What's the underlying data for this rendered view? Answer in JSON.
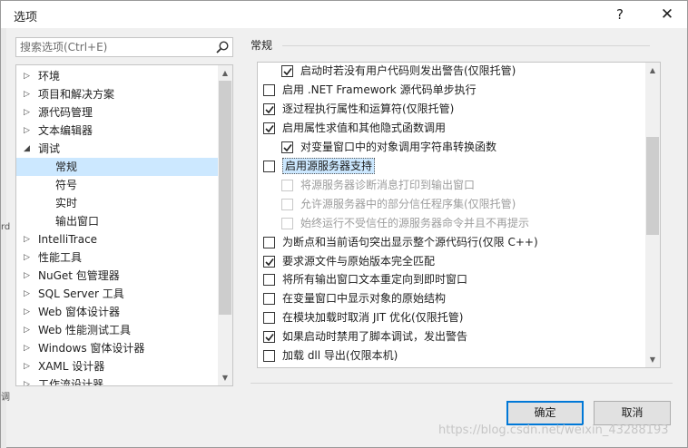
{
  "window": {
    "title": "选项",
    "help": "?",
    "close": "✕"
  },
  "search": {
    "placeholder": "搜索选项(Ctrl+E)"
  },
  "tree": {
    "items": [
      {
        "label": "环境",
        "level": 0,
        "expanded": false
      },
      {
        "label": "项目和解决方案",
        "level": 0,
        "expanded": false
      },
      {
        "label": "源代码管理",
        "level": 0,
        "expanded": false
      },
      {
        "label": "文本编辑器",
        "level": 0,
        "expanded": false
      },
      {
        "label": "调试",
        "level": 0,
        "expanded": true
      },
      {
        "label": "常规",
        "level": 1,
        "selected": true
      },
      {
        "label": "符号",
        "level": 1
      },
      {
        "label": "实时",
        "level": 1
      },
      {
        "label": "输出窗口",
        "level": 1
      },
      {
        "label": "IntelliTrace",
        "level": 0,
        "expanded": false
      },
      {
        "label": "性能工具",
        "level": 0,
        "expanded": false
      },
      {
        "label": "NuGet 包管理器",
        "level": 0,
        "expanded": false
      },
      {
        "label": "SQL Server 工具",
        "level": 0,
        "expanded": false
      },
      {
        "label": "Web 窗体设计器",
        "level": 0,
        "expanded": false
      },
      {
        "label": "Web 性能测试工具",
        "level": 0,
        "expanded": false
      },
      {
        "label": "Windows 窗体设计器",
        "level": 0,
        "expanded": false
      },
      {
        "label": "XAML 设计器",
        "level": 0,
        "expanded": false
      },
      {
        "label": "工作流设计器",
        "level": 0,
        "expanded": false
      }
    ]
  },
  "section": {
    "title": "常规"
  },
  "options": [
    {
      "label": "启动时若没有用户代码则发出警告(仅限托管)",
      "checked": true,
      "indent": 1,
      "enabled": true
    },
    {
      "label": "启用 .NET Framework 源代码单步执行",
      "checked": false,
      "indent": 0,
      "enabled": true
    },
    {
      "label": "逐过程执行属性和运算符(仅限托管)",
      "checked": true,
      "indent": 0,
      "enabled": true
    },
    {
      "label": "启用属性求值和其他隐式函数调用",
      "checked": true,
      "indent": 0,
      "enabled": true
    },
    {
      "label": "对变量窗口中的对象调用字符串转换函数",
      "checked": true,
      "indent": 1,
      "enabled": true
    },
    {
      "label": "启用源服务器支持",
      "checked": false,
      "indent": 0,
      "enabled": true,
      "focused": true
    },
    {
      "label": "将源服务器诊断消息打印到输出窗口",
      "checked": false,
      "indent": 1,
      "enabled": false
    },
    {
      "label": "允许源服务器中的部分信任程序集(仅限托管)",
      "checked": false,
      "indent": 1,
      "enabled": false
    },
    {
      "label": "始终运行不受信任的源服务器命令并且不再提示",
      "checked": false,
      "indent": 1,
      "enabled": false
    },
    {
      "label": "为断点和当前语句突出显示整个源代码行(仅限 C++)",
      "checked": false,
      "indent": 0,
      "enabled": true
    },
    {
      "label": "要求源文件与原始版本完全匹配",
      "checked": true,
      "indent": 0,
      "enabled": true
    },
    {
      "label": "将所有输出窗口文本重定向到即时窗口",
      "checked": false,
      "indent": 0,
      "enabled": true
    },
    {
      "label": "在变量窗口中显示对象的原始结构",
      "checked": false,
      "indent": 0,
      "enabled": true
    },
    {
      "label": "在模块加载时取消 JIT 优化(仅限托管)",
      "checked": false,
      "indent": 0,
      "enabled": true
    },
    {
      "label": "如果启动时禁用了脚本调试，发出警告",
      "checked": true,
      "indent": 0,
      "enabled": true
    },
    {
      "label": "加载 dll 导出(仅限本机)",
      "checked": false,
      "indent": 0,
      "enabled": true
    }
  ],
  "buttons": {
    "ok": "确定",
    "cancel": "取消"
  },
  "edge_fragments": [
    "rd",
    "调"
  ],
  "watermark": "https://blog.csdn.net/weixin_43288193",
  "colors": {
    "accent": "#0078d7",
    "selection": "#cce8ff"
  }
}
